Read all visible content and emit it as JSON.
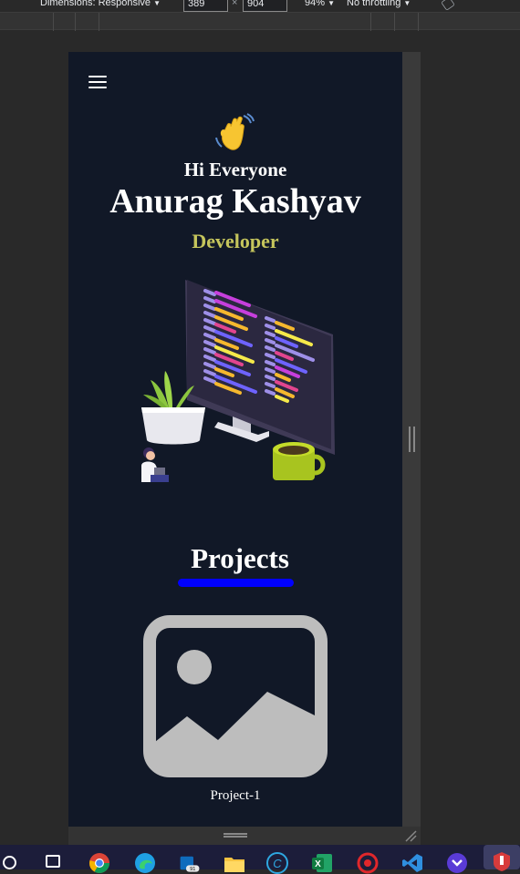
{
  "devtools": {
    "dimensions_label": "Dimensions: Responsive",
    "width_value": "389",
    "times": "×",
    "height_value": "904",
    "zoom": "94%",
    "throttling": "No throttling"
  },
  "page": {
    "greeting": "Hi Everyone",
    "name": "Anurag Kashyav",
    "role": "Developer",
    "projects_heading": "Projects",
    "projects": [
      {
        "label": "Project-1",
        "icon": "image-placeholder-icon"
      }
    ]
  },
  "colors": {
    "background": "#111827",
    "role": "#c5c55c",
    "underline": "#0000ff",
    "placeholder": "#bdbdbd"
  },
  "taskbar": {
    "apps": [
      "search-icon",
      "task-view-icon",
      "chrome-icon",
      "edge-icon",
      "outlook-icon",
      "file-explorer-icon",
      "ccleaner-icon",
      "excel-icon",
      "antivirus-icon",
      "vscode-icon",
      "visual-studio-icon",
      "app-icon"
    ]
  }
}
